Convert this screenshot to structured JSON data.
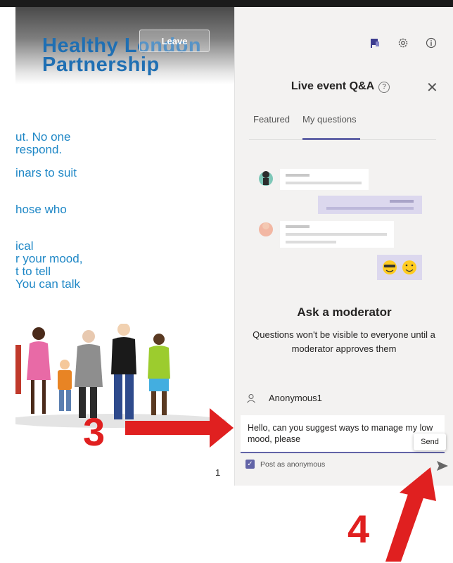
{
  "slide": {
    "logo_line1": "Healthy London",
    "logo_line2": "Partnership",
    "leave_label": "Leave",
    "text_block1": "ut. No one\nrespond.",
    "text_block2": "inars to suit",
    "text_block3": "hose who",
    "text_block4": "ical\nr your mood,\nt to tell\nYou can talk",
    "page_number": "1"
  },
  "panel": {
    "title": "Live event Q&A",
    "tabs": [
      "Featured",
      "My questions"
    ],
    "active_tab": "My questions",
    "ask_title": "Ask a moderator",
    "ask_description": "Questions won't be visible to everyone until a moderator approves them",
    "user_name": "Anonymous1",
    "message_text": "Hello, can you suggest ways to manage my low mood, please",
    "send_tooltip": "Send",
    "post_anonymous_label": "Post as anonymous",
    "post_anonymous_checked": true
  },
  "annotations": {
    "step3": "3",
    "step4": "4"
  },
  "colors": {
    "accent": "#6264a7",
    "annotation": "#e02020",
    "slide_text": "#1e87c6",
    "logo": "#1f6fb3"
  },
  "icons": [
    "flag-icon",
    "gear-icon",
    "info-icon",
    "help-icon",
    "close-icon",
    "person-icon",
    "check-icon",
    "send-icon"
  ]
}
